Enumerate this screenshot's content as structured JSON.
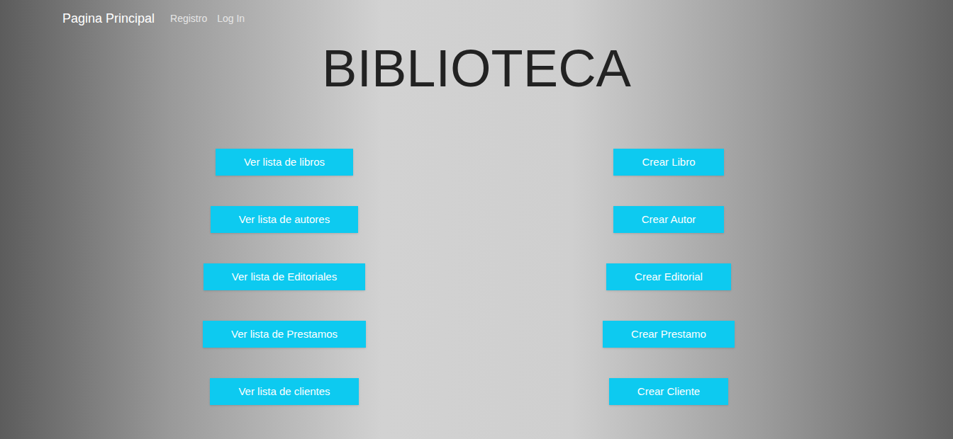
{
  "navbar": {
    "brand": "Pagina Principal",
    "links": [
      {
        "label": "Registro"
      },
      {
        "label": "Log In"
      }
    ]
  },
  "title": "BIBLIOTECA",
  "actions": [
    {
      "view": "Ver lista de libros",
      "create": "Crear Libro"
    },
    {
      "view": "Ver lista de autores",
      "create": "Crear Autor"
    },
    {
      "view": "Ver lista de Editoriales",
      "create": "Crear Editorial"
    },
    {
      "view": "Ver lista de Prestamos",
      "create": "Crear Prestamo"
    },
    {
      "view": "Ver lista de clientes",
      "create": "Crear Cliente"
    }
  ]
}
